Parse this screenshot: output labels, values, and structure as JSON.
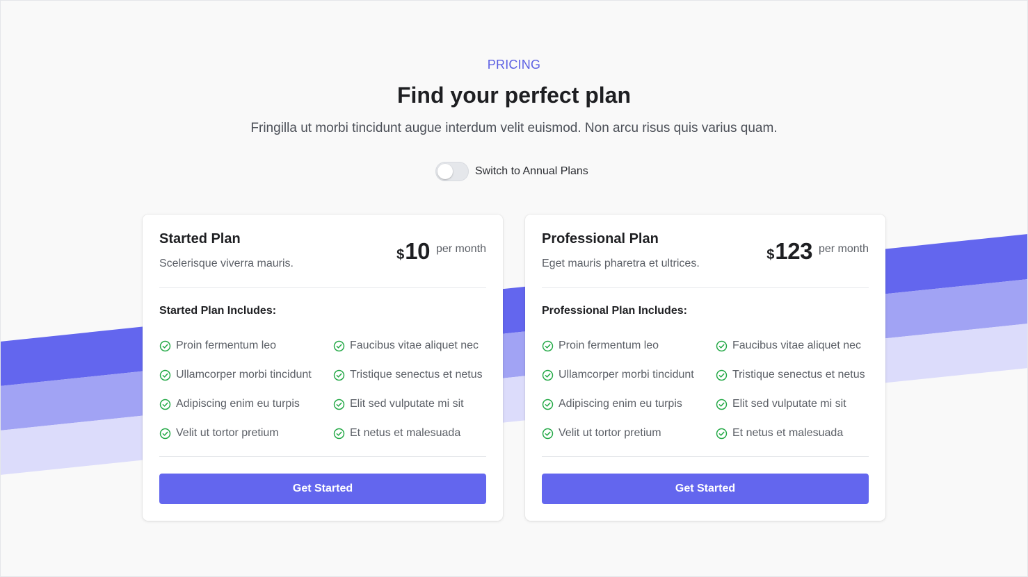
{
  "colors": {
    "accent": "#6366EE",
    "eyebrow": "#5B5FE3",
    "stripe_dark": "#6366EE",
    "stripe_mid": "#A1A3F4",
    "stripe_light": "#DCDCFB",
    "check": "#22A845"
  },
  "header": {
    "eyebrow": "PRICING",
    "title": "Find your perfect plan",
    "subtitle": "Fringilla ut morbi tincidunt augue interdum velit euismod. Non arcu risus quis varius quam."
  },
  "billing_toggle": {
    "label": "Switch to Annual Plans",
    "checked": false
  },
  "plans": [
    {
      "name": "Started Plan",
      "description": "Scelerisque viverra mauris.",
      "currency": "$",
      "price": "10",
      "period": "per month",
      "includes_title": "Started Plan Includes:",
      "features": [
        "Proin fermentum leo",
        "Faucibus vitae aliquet nec",
        "Ullamcorper morbi tincidunt",
        "Tristique senectus et netus",
        "Adipiscing enim eu turpis",
        "Elit sed vulputate mi sit",
        "Velit ut tortor pretium",
        "Et netus et malesuada"
      ],
      "cta": "Get Started"
    },
    {
      "name": "Professional Plan",
      "description": "Eget mauris pharetra et ultrices.",
      "currency": "$",
      "price": "123",
      "period": "per month",
      "includes_title": "Professional Plan Includes:",
      "features": [
        "Proin fermentum leo",
        "Faucibus vitae aliquet nec",
        "Ullamcorper morbi tincidunt",
        "Tristique senectus et netus",
        "Adipiscing enim eu turpis",
        "Elit sed vulputate mi sit",
        "Velit ut tortor pretium",
        "Et netus et malesuada"
      ],
      "cta": "Get Started"
    }
  ],
  "icons": {
    "feature": "check-circle-icon"
  }
}
